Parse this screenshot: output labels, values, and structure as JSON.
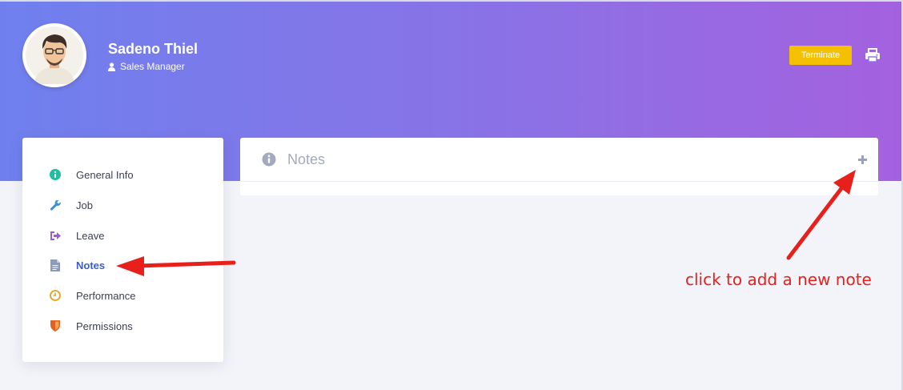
{
  "profile": {
    "name": "Sadeno Thiel",
    "role": "Sales Manager"
  },
  "actions": {
    "terminate_label": "Terminate",
    "print_icon": "print-icon"
  },
  "sidebar": {
    "items": [
      {
        "label": "General Info",
        "icon": "info-circle-icon",
        "color": "#1fbfa0",
        "active": false
      },
      {
        "label": "Job",
        "icon": "wrench-icon",
        "color": "#3d8fd6",
        "active": false
      },
      {
        "label": "Leave",
        "icon": "sign-out-icon",
        "color": "#a05ad6",
        "active": false
      },
      {
        "label": "Notes",
        "icon": "file-text-icon",
        "color": "#8d9bb8",
        "active": true
      },
      {
        "label": "Performance",
        "icon": "clock-icon",
        "color": "#e8a020",
        "active": false
      },
      {
        "label": "Permissions",
        "icon": "shield-icon",
        "color": "#e0621c",
        "active": false
      }
    ]
  },
  "notes_panel": {
    "title": "Notes",
    "add_icon": "plus-icon"
  },
  "annotation": {
    "text": "click to add a new note",
    "color": "#e8201c"
  },
  "colors": {
    "header_gradient_start": "#6f80ee",
    "header_gradient_end": "#a461df",
    "terminate_button": "#f5c000",
    "active_nav": "#3b5ec4"
  }
}
